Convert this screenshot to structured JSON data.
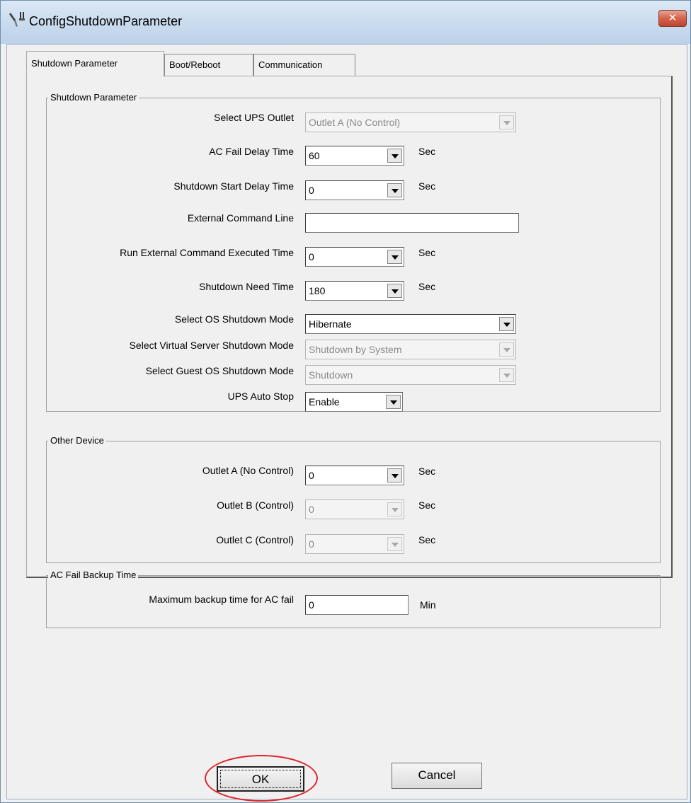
{
  "window": {
    "title": "ConfigShutdownParameter",
    "close_glyph": "✕"
  },
  "tabs": [
    {
      "label": "Shutdown Parameter",
      "active": true
    },
    {
      "label": "Boot/Reboot",
      "active": false
    },
    {
      "label": "Communication",
      "active": false
    }
  ],
  "shutdown_group": {
    "title": "Shutdown Parameter",
    "select_ups_outlet": {
      "label": "Select UPS Outlet",
      "value": "Outlet A (No Control)"
    },
    "ac_fail_delay": {
      "label": "AC Fail Delay Time",
      "value": "60",
      "unit": "Sec"
    },
    "shutdown_start_delay": {
      "label": "Shutdown Start Delay Time",
      "value": "0",
      "unit": "Sec"
    },
    "external_command_line": {
      "label": "External Command Line",
      "value": ""
    },
    "run_external_command_time": {
      "label": "Run External Command Executed Time",
      "value": "0",
      "unit": "Sec"
    },
    "shutdown_need_time": {
      "label": "Shutdown Need Time",
      "value": "180",
      "unit": "Sec"
    },
    "os_shutdown_mode": {
      "label": "Select OS Shutdown Mode",
      "value": "Hibernate"
    },
    "virtual_server_shutdown_mode": {
      "label": "Select Virtual Server Shutdown Mode",
      "value": "Shutdown by System"
    },
    "guest_os_shutdown_mode": {
      "label": "Select Guest OS Shutdown Mode",
      "value": "Shutdown"
    },
    "ups_auto_stop": {
      "label": "UPS Auto Stop",
      "value": "Enable"
    }
  },
  "other_device_group": {
    "title": "Other Device",
    "outlet_a": {
      "label": "Outlet A (No Control)",
      "value": "0",
      "unit": "Sec"
    },
    "outlet_b": {
      "label": "Outlet B (Control)",
      "value": "0",
      "unit": "Sec"
    },
    "outlet_c": {
      "label": "Outlet C (Control)",
      "value": "0",
      "unit": "Sec"
    }
  },
  "backup_group": {
    "title": "AC Fail Backup Time",
    "max_backup_time": {
      "label": "Maximum backup time for AC fail",
      "value": "0",
      "unit": "Min"
    }
  },
  "buttons": {
    "ok": "OK",
    "cancel": "Cancel"
  },
  "colors": {
    "highlight_ellipse": "#e0242c",
    "close_button": "#c0432e"
  }
}
